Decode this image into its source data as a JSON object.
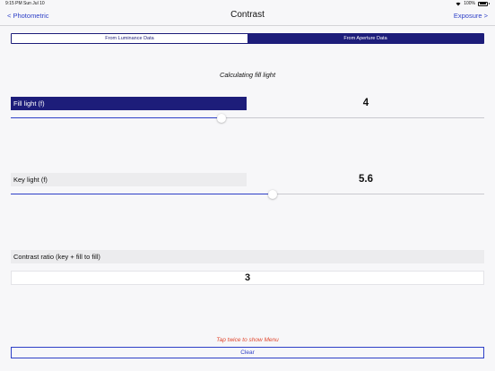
{
  "status_bar": {
    "time": "9:15 PM",
    "date": "Sun Jul 10",
    "battery": "100%"
  },
  "navbar": {
    "back_label": "< Photometric",
    "title": "Contrast",
    "forward_label": "Exposure >"
  },
  "segments": [
    {
      "label": "From Luminance Data",
      "selected": false
    },
    {
      "label": "From Aperture Data",
      "selected": true
    }
  ],
  "section_caption": "Calculating fill light",
  "fill_light": {
    "label": "Fill light (f)",
    "value": "4",
    "slider_fraction": 0.445
  },
  "key_light": {
    "label": "Key light (f)",
    "value": "5.6",
    "slider_fraction": 0.553
  },
  "contrast": {
    "label": "Contrast ratio (key + fill to fill)",
    "value": "3"
  },
  "hint": "Tap twice to show Menu",
  "clear_label": "Clear",
  "colors": {
    "accent": "#2d3fc7",
    "navy": "#1d1d7a",
    "hint": "#e0452c"
  }
}
